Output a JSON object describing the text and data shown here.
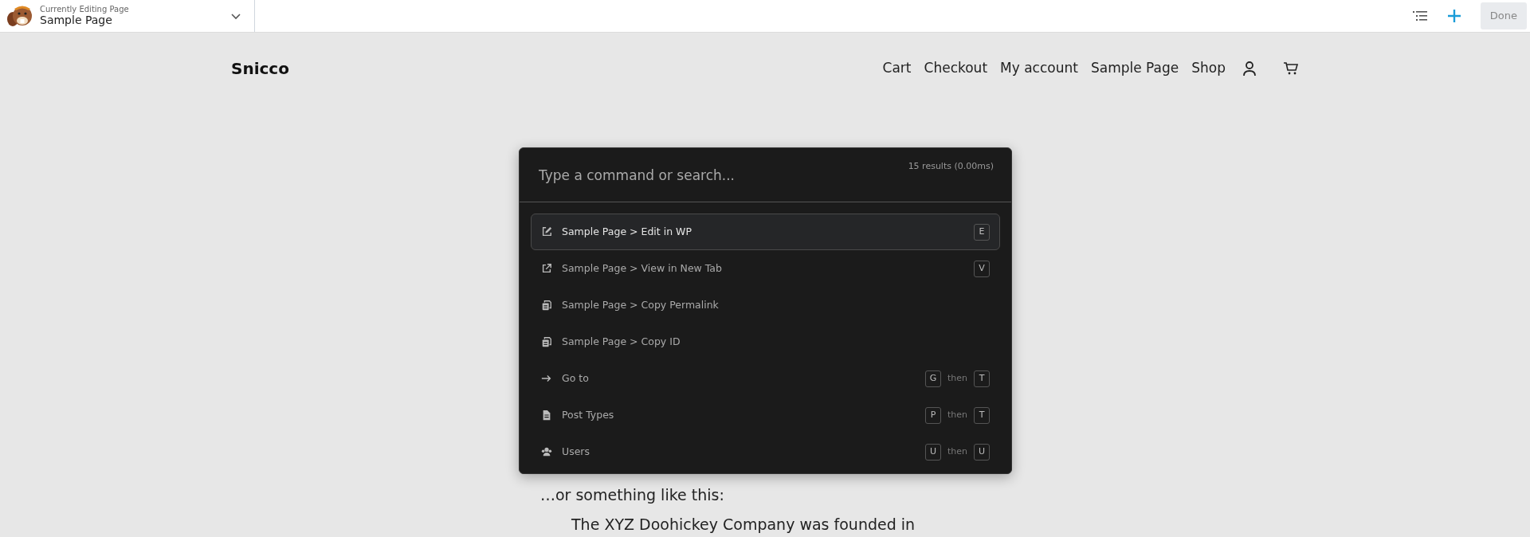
{
  "editor_bar": {
    "label": "Currently Editing Page",
    "page": "Sample Page",
    "done": "Done"
  },
  "site": {
    "title": "Snicco",
    "menu": [
      "Cart",
      "Checkout",
      "My account",
      "Sample Page",
      "Shop"
    ]
  },
  "content": {
    "paragraphs": [
      "…or something like this:"
    ],
    "quote": "The XYZ Doohickey Company was founded in"
  },
  "palette": {
    "placeholder": "Type a command or search...",
    "results": "15 results (0.00ms)",
    "items": [
      {
        "kind": "edit",
        "label": "Sample Page > Edit in WP",
        "selected": true,
        "keys": [
          "E"
        ]
      },
      {
        "kind": "external",
        "label": "Sample Page > View in New Tab",
        "selected": false,
        "keys": [
          "V"
        ]
      },
      {
        "kind": "copy",
        "label": "Sample Page > Copy Permalink",
        "selected": false
      },
      {
        "kind": "copy",
        "label": "Sample Page > Copy ID",
        "selected": false
      },
      {
        "kind": "arrow",
        "label": "Go to",
        "selected": false,
        "keys": [
          "G",
          "T"
        ],
        "joiner": "then"
      },
      {
        "kind": "file",
        "label": "Post Types",
        "selected": false,
        "keys": [
          "P",
          "T"
        ],
        "joiner": "then"
      },
      {
        "kind": "users",
        "label": "Users",
        "selected": false,
        "keys": [
          "U",
          "U"
        ],
        "joiner": "then"
      }
    ]
  }
}
